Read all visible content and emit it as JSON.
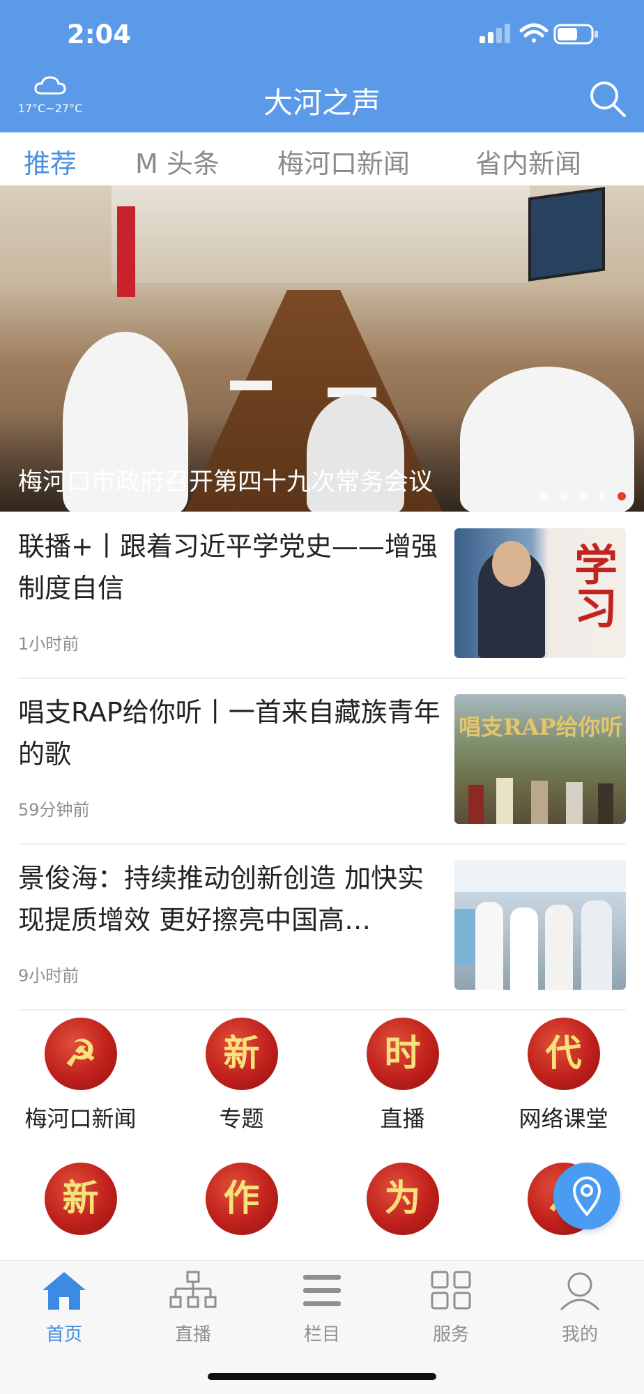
{
  "status": {
    "time": "2:04"
  },
  "header": {
    "weather_temp": "17°C~27°C",
    "title": "大河之声"
  },
  "tabs": [
    {
      "label": "推荐",
      "active": true
    },
    {
      "label": "M 头条",
      "active": false
    },
    {
      "label": "梅河口新闻",
      "active": false
    },
    {
      "label": "省内新闻",
      "active": false
    }
  ],
  "banner": {
    "caption": "梅河口市政府召开第四十九次常务会议",
    "dot_count": 5,
    "active_dot": 5
  },
  "news": [
    {
      "title": "联播+丨跟着习近平学党史——增强制度自信",
      "time": "1小时前"
    },
    {
      "title": "唱支RAP给你听丨一首来自藏族青年的歌",
      "time": "59分钟前"
    },
    {
      "title": "景俊海：持续推动创新创造 加快实现提质增效 更好擦亮中国高…",
      "time": "9小时前"
    }
  ],
  "thumb_texts": {
    "news1": "学习",
    "news2": "唱支RAP给你听"
  },
  "grid": [
    {
      "glyph": "☭",
      "label": "梅河口新闻"
    },
    {
      "glyph": "新",
      "label": "专题"
    },
    {
      "glyph": "时",
      "label": "直播"
    },
    {
      "glyph": "代",
      "label": "网络课堂"
    },
    {
      "glyph": "新",
      "label": ""
    },
    {
      "glyph": "作",
      "label": ""
    },
    {
      "glyph": "为",
      "label": ""
    },
    {
      "glyph": "☭",
      "label": ""
    }
  ],
  "bottom_nav": [
    {
      "label": "首页",
      "icon": "home-icon",
      "active": true
    },
    {
      "label": "直播",
      "icon": "org-chart-icon",
      "active": false
    },
    {
      "label": "栏目",
      "icon": "menu-lines-icon",
      "active": false
    },
    {
      "label": "服务",
      "icon": "grid-icon",
      "active": false
    },
    {
      "label": "我的",
      "icon": "user-icon",
      "active": false
    }
  ],
  "colors": {
    "header_bg": "#5b9ae8",
    "active_tab": "#4a8fe0",
    "nav_active": "#3d8ae3",
    "grid_red": "#c0201b",
    "grid_gold": "#f8e27a"
  }
}
